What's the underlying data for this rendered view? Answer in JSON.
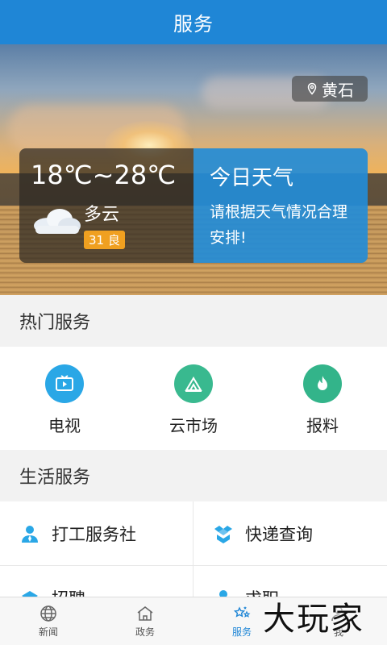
{
  "header": {
    "title": "服务"
  },
  "weather": {
    "location": "黄石",
    "temperature": "18℃~28℃",
    "condition": "多云",
    "aqi": "31 良",
    "title": "今日天气",
    "message": "请根据天气情况合理安排!"
  },
  "hot_services": {
    "title": "热门服务",
    "items": [
      {
        "label": "电视",
        "icon": "tv-icon",
        "color": "#2aa7e6"
      },
      {
        "label": "云市场",
        "icon": "cloud-market-icon",
        "color": "#39b98f"
      },
      {
        "label": "报料",
        "icon": "fire-icon",
        "color": "#33b48a"
      }
    ]
  },
  "life_services": {
    "title": "生活服务",
    "items": [
      {
        "label": "打工服务社",
        "icon": "worker-icon"
      },
      {
        "label": "快递查询",
        "icon": "package-icon"
      },
      {
        "label": "招聘",
        "icon": "recruit-icon"
      },
      {
        "label": "求职",
        "icon": "jobseeker-icon"
      }
    ]
  },
  "bottom_nav": {
    "items": [
      {
        "label": "新闻",
        "icon": "globe-icon"
      },
      {
        "label": "政务",
        "icon": "building-icon"
      },
      {
        "label": "服务",
        "icon": "stars-icon",
        "active": true
      },
      {
        "label": "我",
        "icon": "person-icon"
      }
    ]
  },
  "watermark": "大玩家",
  "colors": {
    "primary": "#1f86d6",
    "aqi": "#f0a020"
  }
}
